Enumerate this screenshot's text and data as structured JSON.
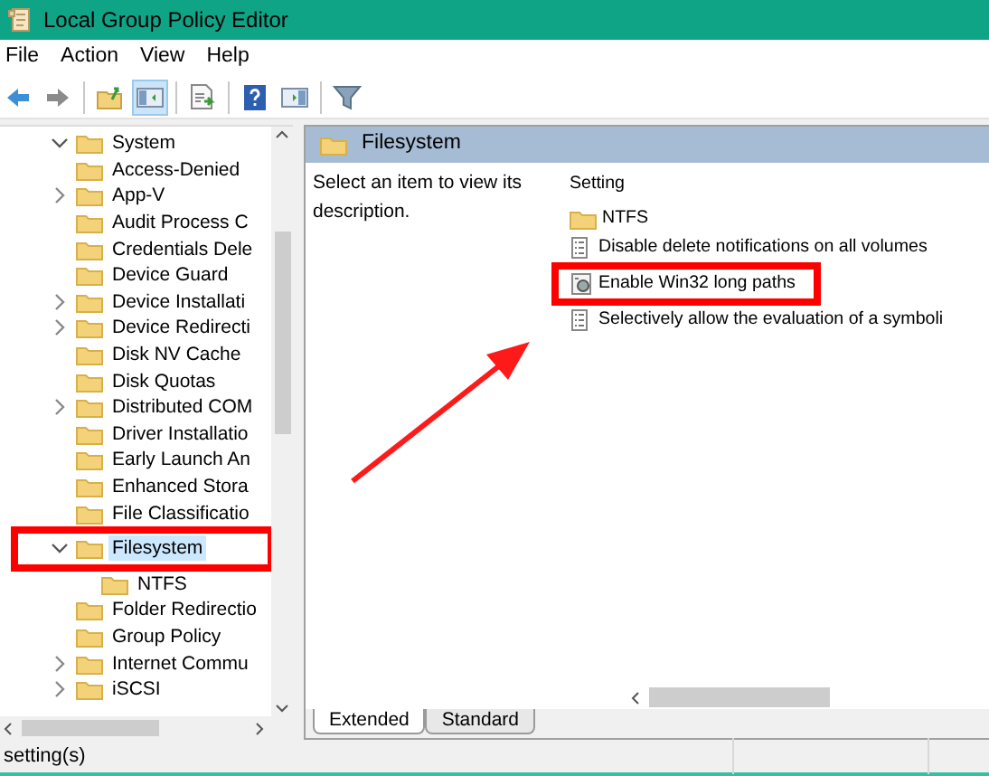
{
  "window": {
    "title": "Local Group Policy Editor"
  },
  "menu": [
    "File",
    "Action",
    "View",
    "Help"
  ],
  "toolbar": [
    [
      {
        "kind": "back",
        "pressed": false
      },
      {
        "kind": "forward",
        "pressed": false
      }
    ],
    [
      {
        "kind": "up",
        "pressed": false
      },
      {
        "kind": "tree",
        "pressed": true
      }
    ],
    [
      {
        "kind": "export",
        "pressed": false
      }
    ],
    [
      {
        "kind": "help",
        "pressed": false
      },
      {
        "kind": "pane",
        "pressed": false
      }
    ],
    [
      {
        "kind": "filter",
        "pressed": false
      }
    ]
  ],
  "tree": [
    {
      "label": "System",
      "expanded": true,
      "selected": false,
      "highlighted": false,
      "children": [
        {
          "label": "Access-Denied",
          "selected": false,
          "highlighted": false
        },
        {
          "label": "App-V",
          "expanded": false,
          "selected": false,
          "highlighted": false
        },
        {
          "label": "Audit Process C",
          "selected": false,
          "highlighted": false
        },
        {
          "label": "Credentials Dele",
          "selected": false,
          "highlighted": false
        },
        {
          "label": "Device Guard",
          "selected": false,
          "highlighted": false
        },
        {
          "label": "Device Installati",
          "expanded": false,
          "selected": false,
          "highlighted": false
        },
        {
          "label": "Device Redirecti",
          "expanded": false,
          "selected": false,
          "highlighted": false
        },
        {
          "label": "Disk NV Cache",
          "selected": false,
          "highlighted": false
        },
        {
          "label": "Disk Quotas",
          "selected": false,
          "highlighted": false
        },
        {
          "label": "Distributed COM",
          "expanded": false,
          "selected": false,
          "highlighted": false
        },
        {
          "label": "Driver Installatio",
          "selected": false,
          "highlighted": false
        },
        {
          "label": "Early Launch An",
          "selected": false,
          "highlighted": false
        },
        {
          "label": "Enhanced Stora",
          "selected": false,
          "highlighted": false
        },
        {
          "label": "File Classificatio",
          "selected": false,
          "highlighted": false
        },
        {
          "label": "Filesystem",
          "expanded": true,
          "selected": true,
          "highlighted": true,
          "children": [
            {
              "label": "NTFS",
              "selected": false,
              "highlighted": false
            }
          ]
        },
        {
          "label": "Folder Redirectio",
          "selected": false,
          "highlighted": false
        },
        {
          "label": "Group Policy",
          "selected": false,
          "highlighted": false
        },
        {
          "label": "Internet Commu",
          "expanded": false,
          "selected": false,
          "highlighted": false
        },
        {
          "label": "iSCSI",
          "expanded": false,
          "selected": false,
          "highlighted": false
        }
      ]
    }
  ],
  "details": {
    "title": "Filesystem",
    "description": "Select an item to view its description.",
    "column": "Setting",
    "rows": [
      {
        "kind": "folder",
        "label": "NTFS",
        "highlighted": false
      },
      {
        "kind": "policy",
        "label": "Disable delete notifications on all volumes",
        "highlighted": false
      },
      {
        "kind": "policy-special",
        "label": "Enable Win32 long paths",
        "highlighted": true
      },
      {
        "kind": "policy",
        "label": "Selectively allow the evaluation of a symboli",
        "highlighted": false
      }
    ],
    "tabs": [
      {
        "label": "Extended",
        "selected": true
      },
      {
        "label": "Standard",
        "selected": false
      }
    ]
  },
  "annotation_arrow": true,
  "status_bar": "setting(s)"
}
